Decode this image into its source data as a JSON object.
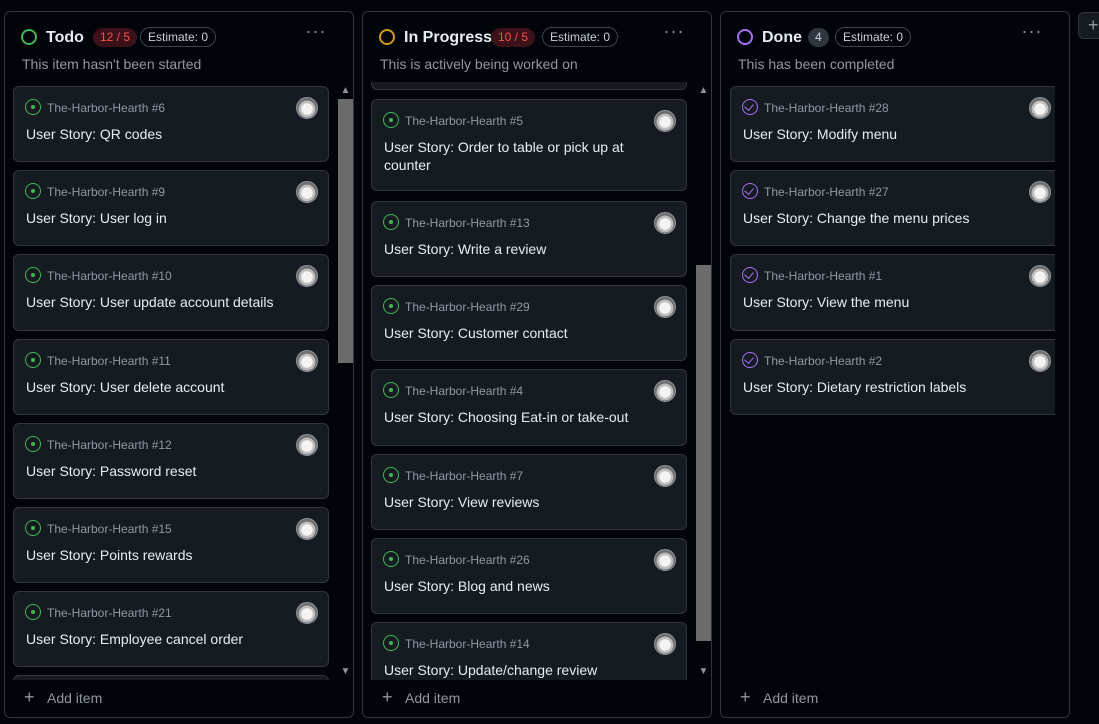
{
  "columns": {
    "todo": {
      "title": "Todo",
      "count": "12 / 5",
      "estimate": "Estimate: 0",
      "description": "This item hasn't been started",
      "status_color": "#3fb950",
      "cards": [
        {
          "repo": "The-Harbor-Hearth #6",
          "title": "User Story: QR codes"
        },
        {
          "repo": "The-Harbor-Hearth #9",
          "title": "User Story: User log in"
        },
        {
          "repo": "The-Harbor-Hearth #10",
          "title": "User Story: User update account details"
        },
        {
          "repo": "The-Harbor-Hearth #11",
          "title": "User Story: User delete account"
        },
        {
          "repo": "The-Harbor-Hearth #12",
          "title": "User Story: Password reset"
        },
        {
          "repo": "The-Harbor-Hearth #15",
          "title": "User Story: Points rewards"
        },
        {
          "repo": "The-Harbor-Hearth #21",
          "title": "User Story: Employee cancel order"
        }
      ],
      "add_item": "Add item"
    },
    "in_progress": {
      "title": "In Progress",
      "count": "10 / 5",
      "estimate": "Estimate: 0",
      "description": "This is actively being worked on",
      "status_color": "#d29922",
      "cards": [
        {
          "repo": "The-Harbor-Hearth #5",
          "title": "User Story: Order to table or pick up at counter"
        },
        {
          "repo": "The-Harbor-Hearth #13",
          "title": "User Story: Write a review"
        },
        {
          "repo": "The-Harbor-Hearth #29",
          "title": "User Story: Customer contact"
        },
        {
          "repo": "The-Harbor-Hearth #4",
          "title": "User Story: Choosing Eat-in or take-out"
        },
        {
          "repo": "The-Harbor-Hearth #7",
          "title": "User Story: View reviews"
        },
        {
          "repo": "The-Harbor-Hearth #26",
          "title": "User Story: Blog and news"
        },
        {
          "repo": "The-Harbor-Hearth #14",
          "title": "User Story: Update/change review"
        }
      ],
      "add_item": "Add item"
    },
    "done": {
      "title": "Done",
      "count": "4",
      "estimate": "Estimate: 0",
      "description": "This has been completed",
      "status_color": "#a371f7",
      "cards": [
        {
          "repo": "The-Harbor-Hearth #28",
          "title": "User Story: Modify menu"
        },
        {
          "repo": "The-Harbor-Hearth #27",
          "title": "User Story: Change the menu prices"
        },
        {
          "repo": "The-Harbor-Hearth #1",
          "title": "User Story: View the menu"
        },
        {
          "repo": "The-Harbor-Hearth #2",
          "title": "User Story: Dietary restriction labels"
        }
      ],
      "add_item": "Add item"
    }
  },
  "add_column": "+",
  "icons": {
    "more": "kebab-horizontal-icon",
    "open_issue": "issue-opened-icon",
    "closed_issue": "issue-closed-icon",
    "plus": "plus-icon"
  }
}
